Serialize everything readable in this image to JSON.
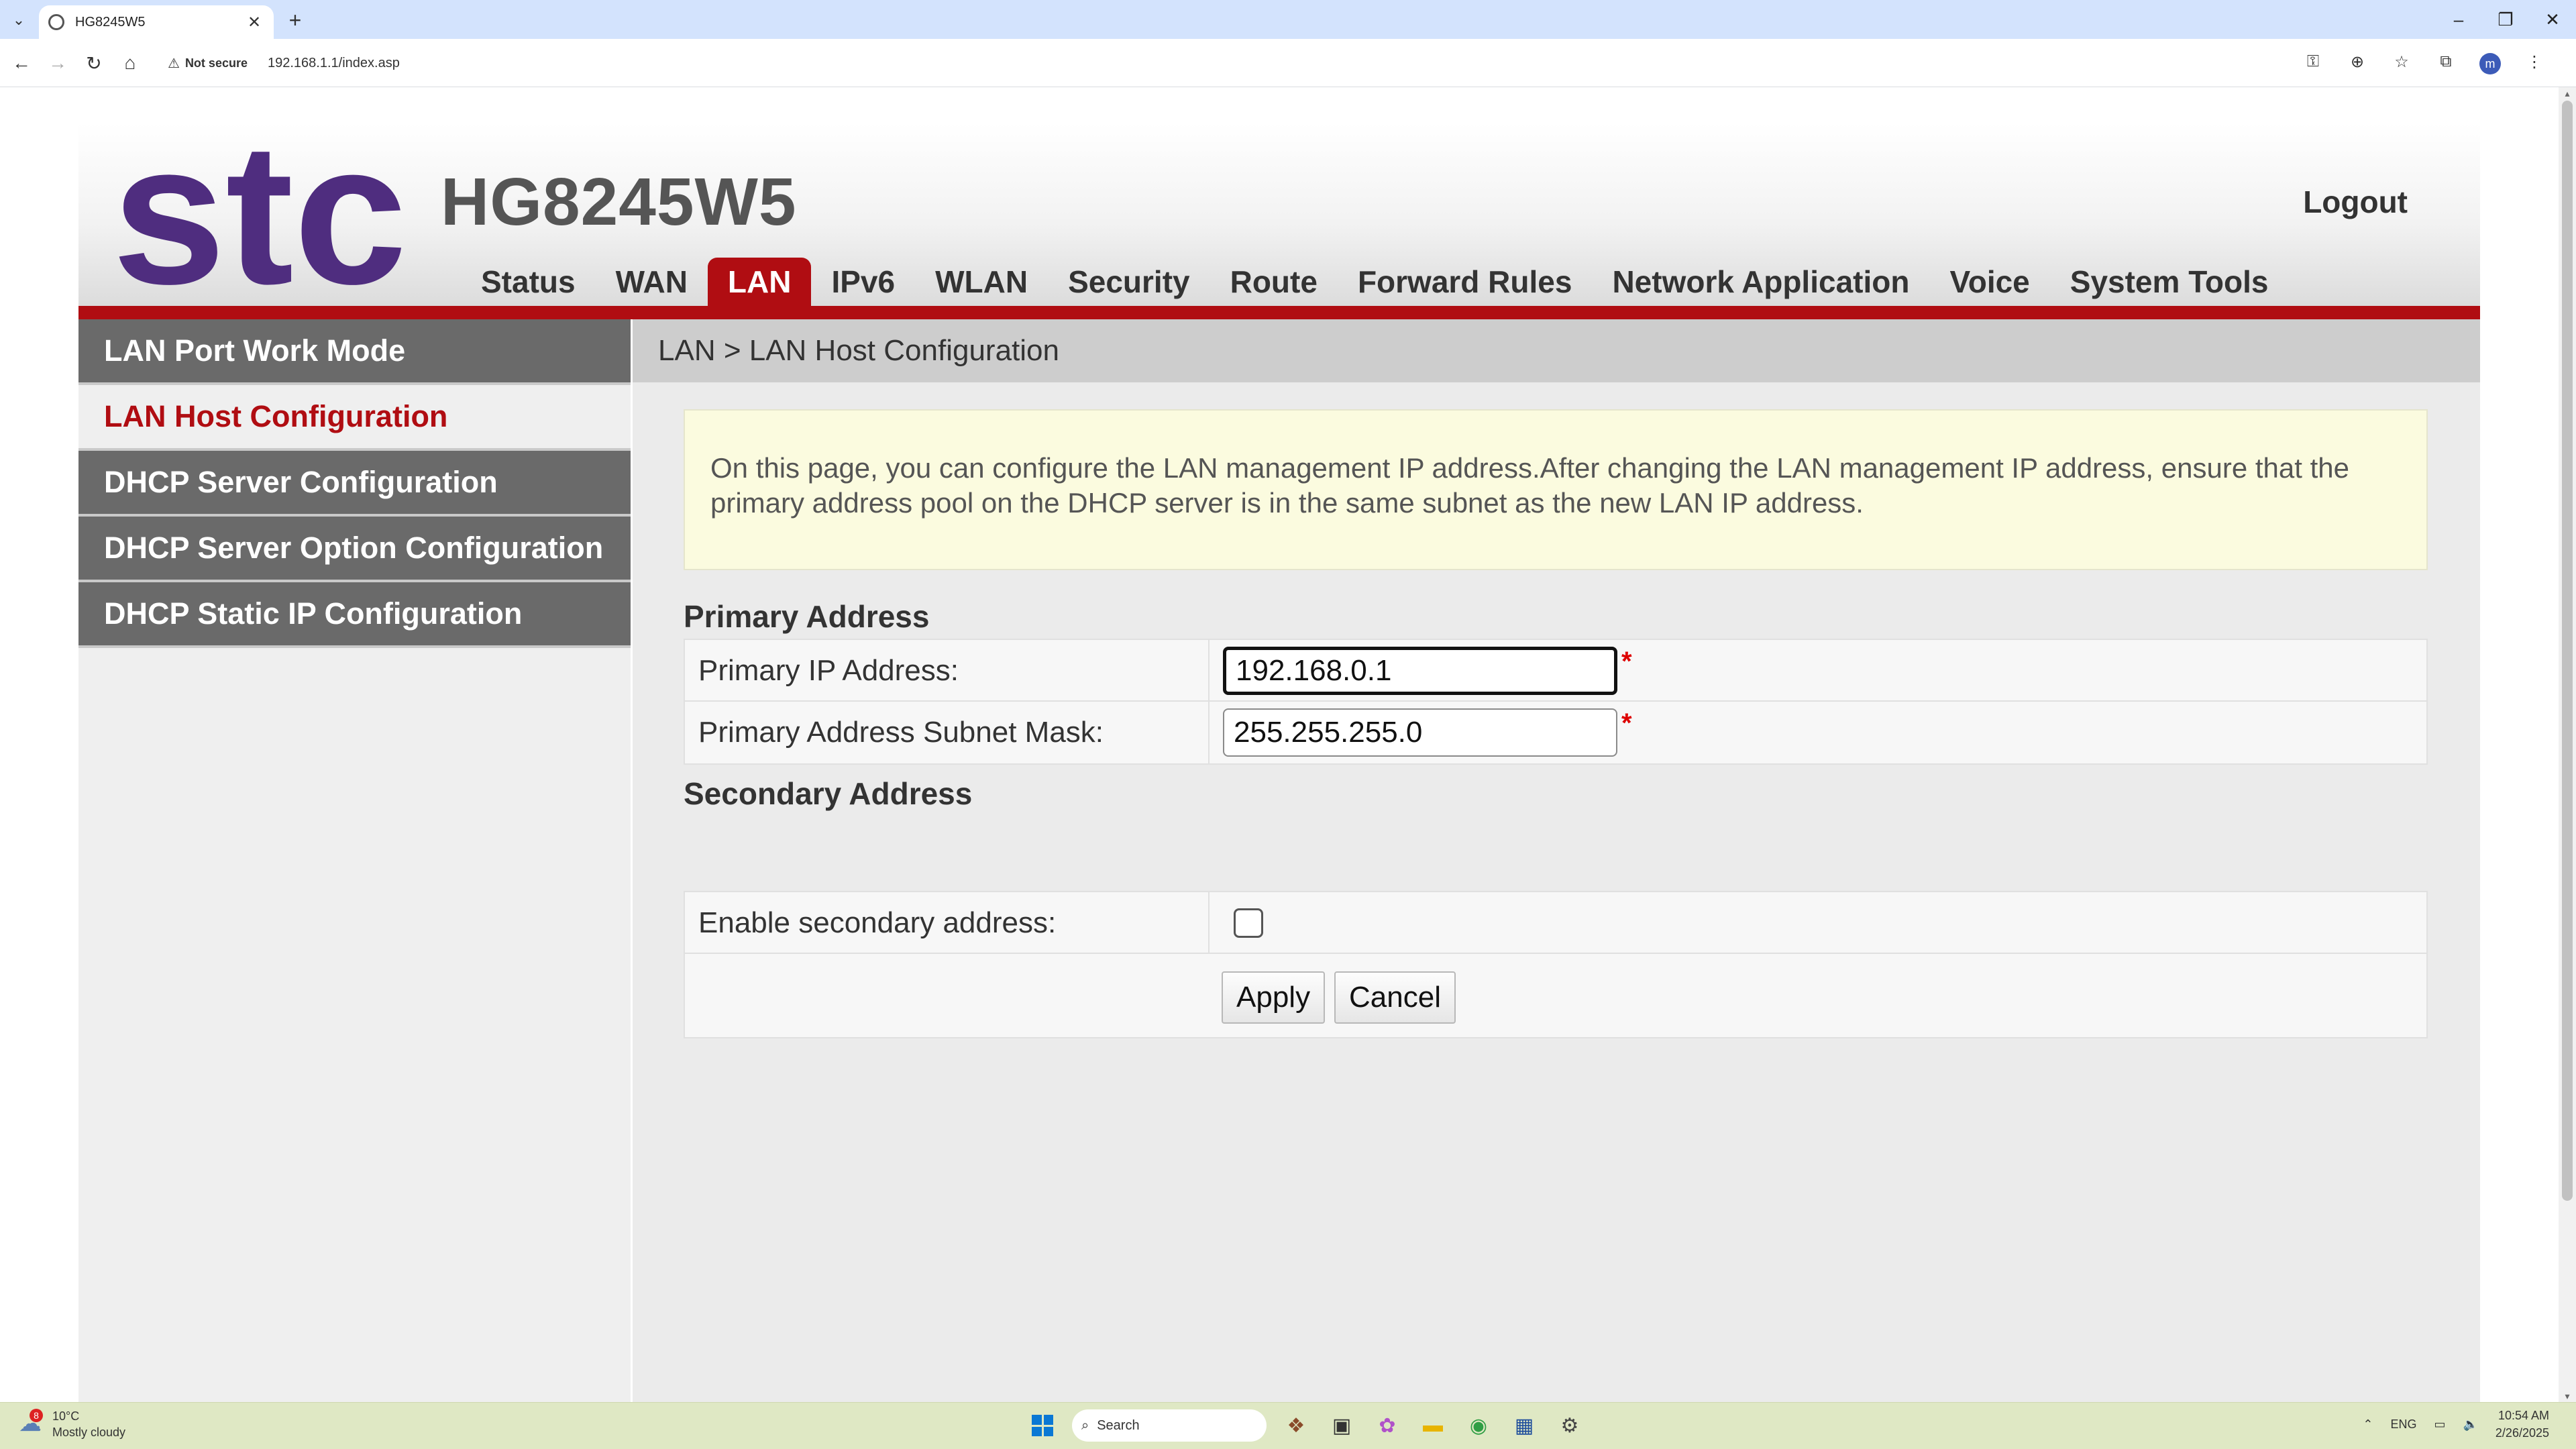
{
  "browser": {
    "tab_title": "HG8245W5",
    "tab_close": "✕",
    "new_tab": "+",
    "security_label": "Not secure",
    "url": "192.168.1.1/index.asp",
    "profile_initial": "m"
  },
  "header": {
    "logo_text": "stc",
    "model": "HG8245W5",
    "logout": "Logout"
  },
  "nav": {
    "items": [
      "Status",
      "WAN",
      "LAN",
      "IPv6",
      "WLAN",
      "Security",
      "Route",
      "Forward Rules",
      "Network Application",
      "Voice",
      "System Tools"
    ],
    "active": "LAN"
  },
  "sidebar": {
    "items": [
      "LAN Port Work Mode",
      "LAN Host Configuration",
      "DHCP Server Configuration",
      "DHCP Server Option Configuration",
      "DHCP Static IP Configuration"
    ],
    "active": "LAN Host Configuration"
  },
  "content": {
    "breadcrumb": "LAN > LAN Host Configuration",
    "notice": "On this page, you can configure the LAN management IP address.After changing the LAN management IP address, ensure that the primary address pool on the DHCP server is in the same subnet as the new LAN IP address.",
    "primary_section": "Primary Address",
    "primary_ip_label": "Primary IP Address:",
    "primary_ip_value": "192.168.0.1",
    "subnet_label": "Primary Address Subnet Mask:",
    "subnet_value": "255.255.255.0",
    "required_mark": "*",
    "secondary_section": "Secondary Address",
    "enable_secondary_label": "Enable secondary address:",
    "enable_secondary_checked": false,
    "apply": "Apply",
    "cancel": "Cancel"
  },
  "taskbar": {
    "weather_temp": "10°C",
    "weather_desc": "Mostly cloudy",
    "weather_badge": "8",
    "search_placeholder": "Search",
    "language": "ENG",
    "time": "10:54 AM",
    "date": "2/26/2025"
  },
  "colors": {
    "brand_red": "#b00d12",
    "stc_purple": "#4f2d7f",
    "sidebar_gray": "#6a6a6a",
    "notice_bg": "#fbfbdf"
  }
}
